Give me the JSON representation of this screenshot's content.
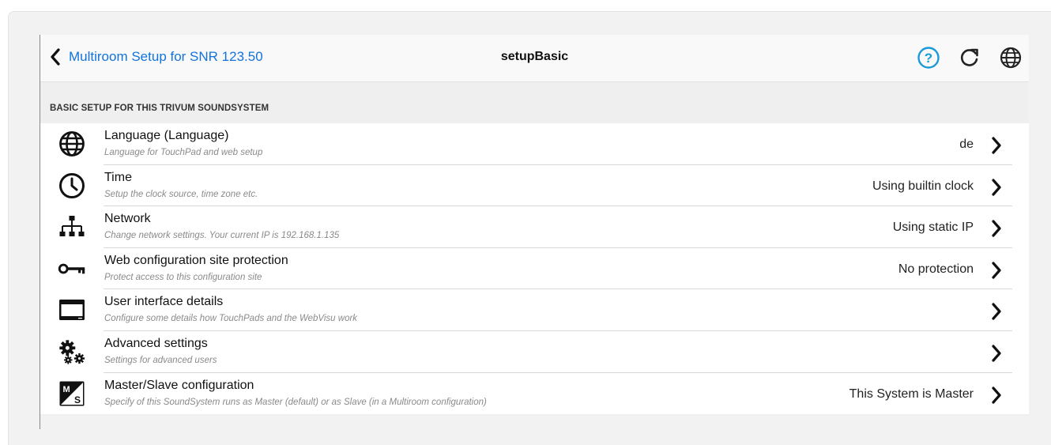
{
  "navbar": {
    "back_label": "Multiroom Setup for SNR 123.50",
    "title": "setupBasic",
    "icons": [
      "help-icon",
      "reload-icon",
      "globe-icon"
    ]
  },
  "section": {
    "header": "BASIC SETUP FOR THIS TRIVUM SOUNDSYSTEM"
  },
  "items": [
    {
      "icon": "globe-icon",
      "title": "Language (Language)",
      "subtitle": "Language for TouchPad and web setup",
      "value": "de"
    },
    {
      "icon": "clock-icon",
      "title": "Time",
      "subtitle": "Setup the clock source, time zone etc.",
      "value": "Using builtin clock"
    },
    {
      "icon": "network-icon",
      "title": "Network",
      "subtitle": "Change network settings. Your current IP is 192.168.1.135",
      "value": "Using static IP"
    },
    {
      "icon": "key-icon",
      "title": "Web configuration site protection",
      "subtitle": "Protect access to this configuration site",
      "value": "No protection"
    },
    {
      "icon": "monitor-icon",
      "title": "User interface details",
      "subtitle": "Configure some details how TouchPads and the WebVisu work",
      "value": ""
    },
    {
      "icon": "gears-icon",
      "title": "Advanced settings",
      "subtitle": "Settings for advanced users",
      "value": ""
    },
    {
      "icon": "master-slave-icon",
      "title": "Master/Slave configuration",
      "subtitle": "Specify of this SoundSystem runs as Master (default) or as Slave (in a Multiroom configuration)",
      "value": "This System is Master"
    }
  ],
  "colors": {
    "link": "#1273de",
    "help_icon": "#1a9ad9",
    "background": "#efeff0"
  }
}
